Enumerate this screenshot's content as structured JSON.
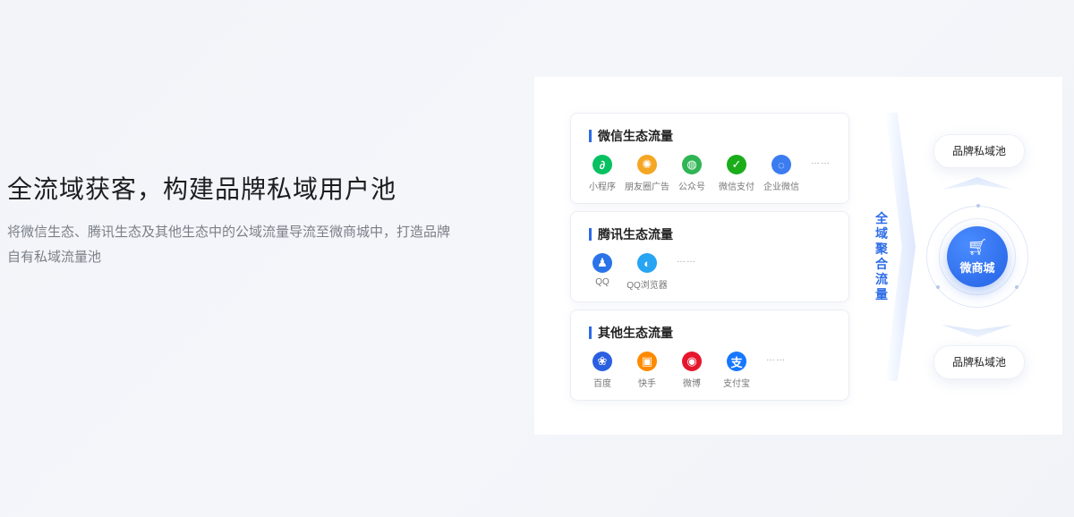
{
  "hero": {
    "title": "全流域获客，构建品牌私域用户池",
    "desc": "将微信生态、腾讯生态及其他生态中的公域流量导流至微商城中，打造品牌自有私域流量池"
  },
  "cards": [
    {
      "title": "微信生态流量",
      "apps": [
        {
          "label": "小程序",
          "icon": "mini-program-icon",
          "glyph": "∂",
          "color": "#07c160"
        },
        {
          "label": "朋友圈广告",
          "icon": "moments-icon",
          "glyph": "✺",
          "color": "#f5a623"
        },
        {
          "label": "公众号",
          "icon": "official-account-icon",
          "glyph": "◍",
          "color": "#2fb554"
        },
        {
          "label": "微信支付",
          "icon": "wechat-pay-icon",
          "glyph": "✓",
          "color": "#1aad19"
        },
        {
          "label": "企业微信",
          "icon": "wecom-icon",
          "glyph": "◌",
          "color": "#3b7cf0"
        }
      ],
      "more": "……"
    },
    {
      "title": "腾讯生态流量",
      "apps": [
        {
          "label": "QQ",
          "icon": "qq-icon",
          "glyph": "♟",
          "color": "#2b74e8"
        },
        {
          "label": "QQ浏览器",
          "icon": "qq-browser-icon",
          "glyph": "◐",
          "color": "#27a4f2"
        }
      ],
      "more": "……"
    },
    {
      "title": "其他生态流量",
      "apps": [
        {
          "label": "百度",
          "icon": "baidu-icon",
          "glyph": "❀",
          "color": "#2a5fe0"
        },
        {
          "label": "快手",
          "icon": "kuaishou-icon",
          "glyph": "▣",
          "color": "#ff8a00"
        },
        {
          "label": "微博",
          "icon": "weibo-icon",
          "glyph": "◉",
          "color": "#e6162d"
        },
        {
          "label": "支付宝",
          "icon": "alipay-icon",
          "glyph": "支",
          "color": "#1677ff"
        }
      ],
      "more": "……"
    }
  ],
  "flow_label": "全域聚合流量",
  "hub": {
    "name": "微商城",
    "icon": "shopping-cart-icon"
  },
  "pools": {
    "top": "品牌私域池",
    "bottom": "品牌私域池"
  }
}
